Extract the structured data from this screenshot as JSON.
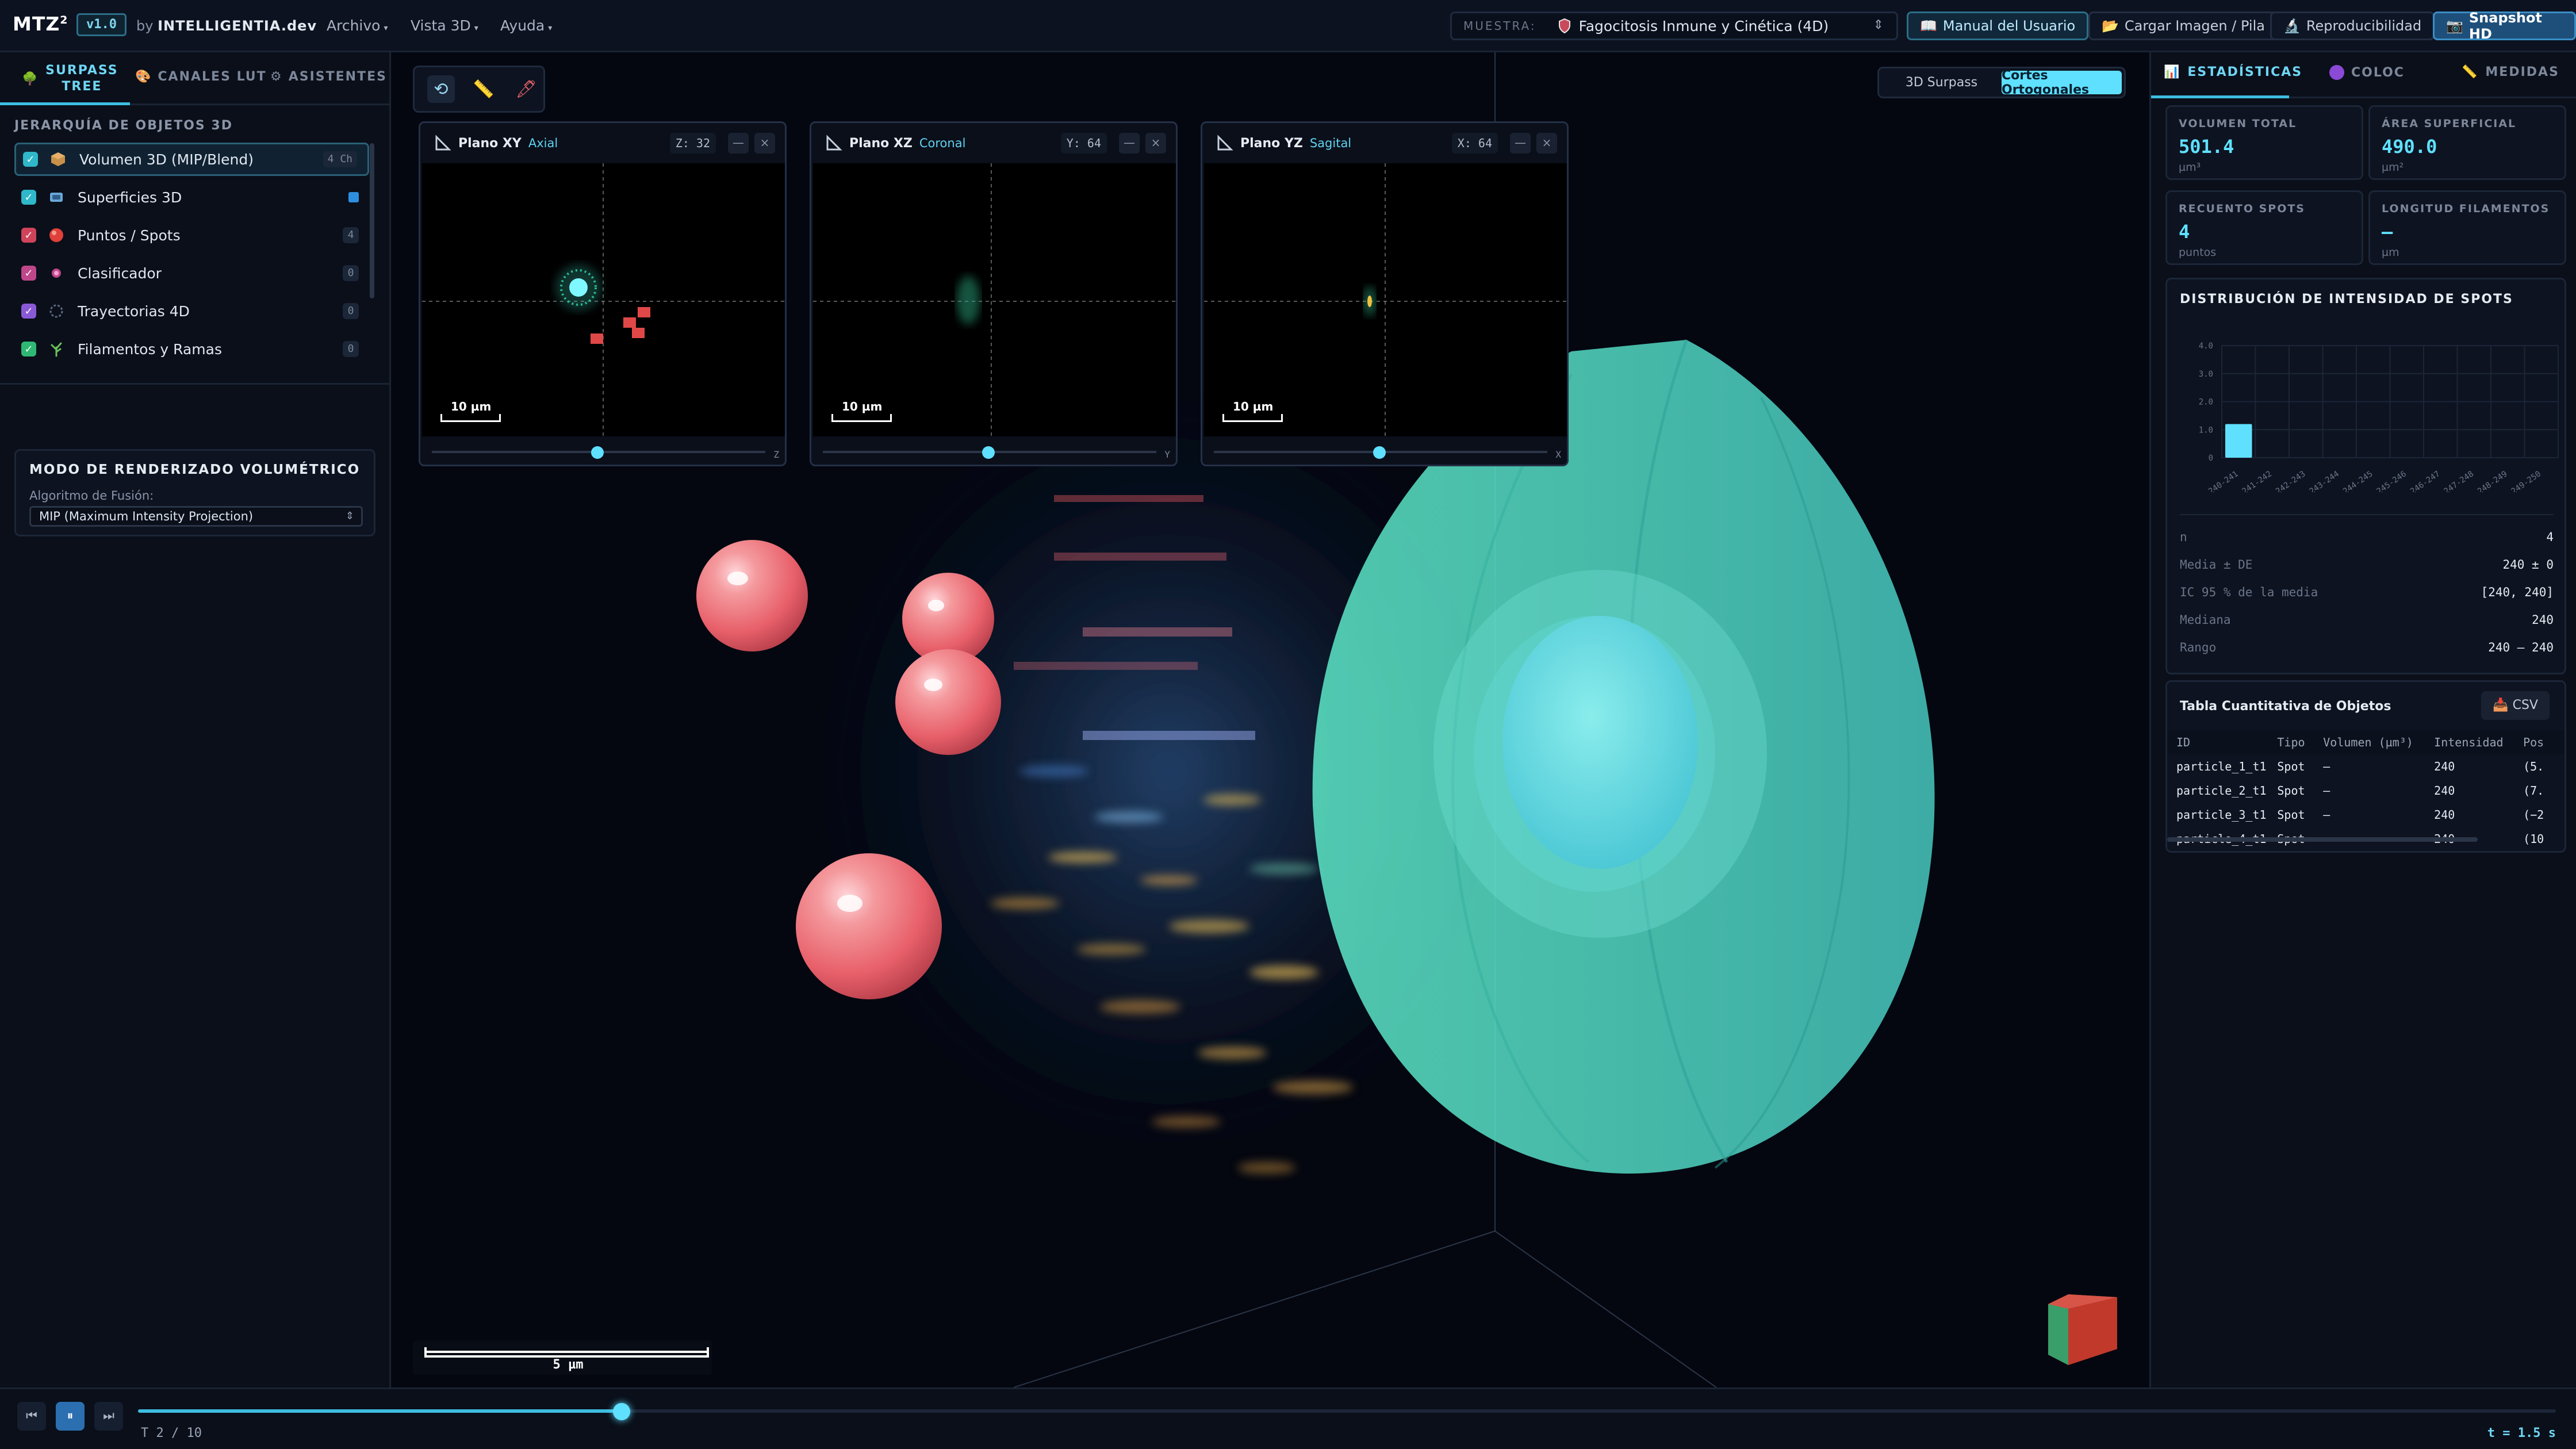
{
  "app": {
    "name": "MTZ",
    "sup": "2",
    "version": "v1.0",
    "by": "by",
    "brand": "INTELLIGENTIA.dev"
  },
  "menu": [
    {
      "label": "Archivo"
    },
    {
      "label": "Vista 3D"
    },
    {
      "label": "Ayuda"
    }
  ],
  "sample": {
    "label": "MUESTRA:",
    "value": "Fagocitosis Inmune y Cinética (4D)"
  },
  "toolbar": {
    "manual": "Manual del Usuario",
    "load": "Cargar Imagen / Pila",
    "repro": "Reproducibilidad",
    "snapshot": "Snapshot HD"
  },
  "left": {
    "tabs": [
      {
        "label": "SURPASS TREE"
      },
      {
        "label": "CANALES LUT"
      },
      {
        "label": "ASISTENTES"
      }
    ],
    "tree_title": "JERARQUÍA DE OBJETOS 3D",
    "tree": [
      {
        "label": "Volumen 3D (MIP/Blend)",
        "badge": "4 Ch",
        "check_color": "#2fb8c9",
        "icon": "cube-icon"
      },
      {
        "label": "Superficies 3D",
        "badge": "",
        "check_color": "#2fb8c9",
        "icon": "surface-icon"
      },
      {
        "label": "Puntos / Spots",
        "badge": "4",
        "check_color": "#d0445a",
        "icon": "spot-icon"
      },
      {
        "label": "Clasificador",
        "badge": "0",
        "check_color": "#c0468a",
        "icon": "classifier-icon"
      },
      {
        "label": "Trayectorias 4D",
        "badge": "0",
        "check_color": "#8a5ad6",
        "icon": "trajectory-icon"
      },
      {
        "label": "Filamentos y Ramas",
        "badge": "0",
        "check_color": "#2fb873",
        "icon": "filament-icon"
      }
    ],
    "render": {
      "title": "MODO DE RENDERIZADO VOLUMÉTRICO",
      "sub": "Algoritmo de Fusión:",
      "value": "MIP (Maximum Intensity Projection)"
    }
  },
  "view": {
    "modes": [
      {
        "label": "3D Surpass"
      },
      {
        "label": "Cortes Ortogonales"
      }
    ],
    "panels": [
      {
        "title": "Plano XY",
        "sub": "Axial",
        "coord": "Z: 32",
        "axis": "Z",
        "scale": "10 µm",
        "slider": 0.5
      },
      {
        "title": "Plano XZ",
        "sub": "Coronal",
        "coord": "Y: 64",
        "axis": "Y",
        "scale": "10 µm",
        "slider": 0.5
      },
      {
        "title": "Plano YZ",
        "sub": "Sagital",
        "coord": "X: 64",
        "axis": "X",
        "scale": "10 µm",
        "slider": 0.5
      }
    ],
    "scale": "5 µm"
  },
  "right": {
    "tabs": [
      {
        "label": "ESTADÍSTICAS"
      },
      {
        "label": "COLOC"
      },
      {
        "label": "MEDIDAS"
      }
    ],
    "stats": [
      {
        "label": "VOLUMEN TOTAL",
        "value": "501.4",
        "unit": "µm³"
      },
      {
        "label": "ÁREA SUPERFICIAL",
        "value": "490.0",
        "unit": "µm²"
      },
      {
        "label": "RECUENTO SPOTS",
        "value": "4",
        "unit": "puntos"
      },
      {
        "label": "LONGITUD FILAMENTOS",
        "value": "—",
        "unit": "µm"
      }
    ],
    "hist_title": "DISTRIBUCIÓN DE INTENSIDAD DE SPOTS",
    "summary": [
      {
        "k": "n",
        "v": "4"
      },
      {
        "k": "Media ± DE",
        "v": "240 ± 0"
      },
      {
        "k": "IC 95 % de la media",
        "v": "[240, 240]"
      },
      {
        "k": "Mediana",
        "v": "240"
      },
      {
        "k": "Rango",
        "v": "240 — 240"
      }
    ],
    "table": {
      "title": "Tabla Cuantitativa de Objetos",
      "csv": "CSV",
      "headers": [
        "ID",
        "Tipo",
        "Volumen (µm³)",
        "Intensidad",
        "Pos"
      ],
      "rows": [
        [
          "particle_1_t1",
          "Spot",
          "–",
          "240",
          "(5."
        ],
        [
          "particle_2_t1",
          "Spot",
          "–",
          "240",
          "(7."
        ],
        [
          "particle_3_t1",
          "Spot",
          "–",
          "240",
          "(−2"
        ],
        [
          "particle_4_t1",
          "Spot",
          "–",
          "240",
          "(10"
        ]
      ]
    }
  },
  "timeline": {
    "label": "T 2 / 10",
    "time": "t = 1.5 s",
    "progress": 0.2
  },
  "chart_data": {
    "type": "bar",
    "categories": [
      "240-241",
      "241-242",
      "242-243",
      "243-244",
      "244-245",
      "245-246",
      "246-247",
      "247-248",
      "248-249",
      "249-250"
    ],
    "values": [
      1.2,
      0,
      0,
      0,
      0,
      0,
      0,
      0,
      0,
      0
    ],
    "yticks": [
      "4.0",
      "3.0",
      "2.0",
      "1.0",
      "0"
    ],
    "ylim": [
      0,
      4
    ],
    "title": "DISTRIBUCIÓN DE INTENSIDAD DE SPOTS",
    "color": "#5fe0ff"
  }
}
